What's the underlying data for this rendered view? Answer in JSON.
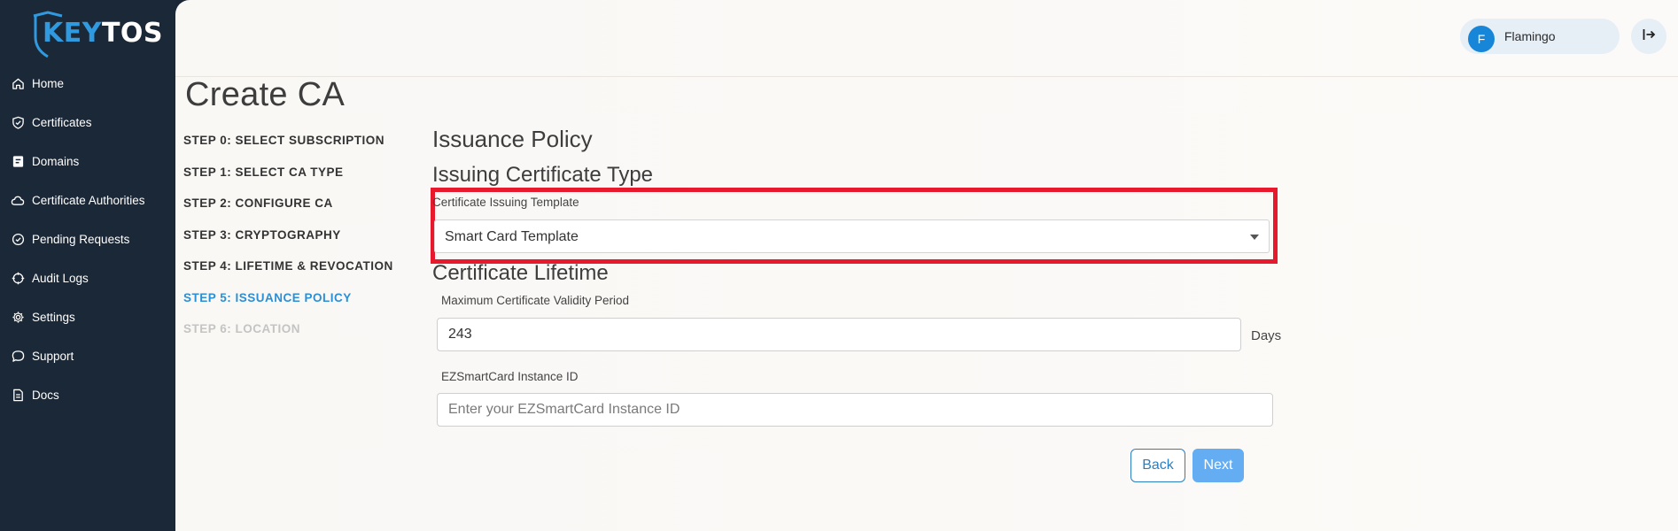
{
  "brand": {
    "logo_key": "KEY",
    "logo_tos": "TOS",
    "accent": "#2f9ae0"
  },
  "sidebar": {
    "items": [
      {
        "label": "Home",
        "icon": "home-icon"
      },
      {
        "label": "Certificates",
        "icon": "shield-check-icon"
      },
      {
        "label": "Domains",
        "icon": "domain-book-icon"
      },
      {
        "label": "Certificate Authorities",
        "icon": "cloud-icon"
      },
      {
        "label": "Pending Requests",
        "icon": "check-circle-icon"
      },
      {
        "label": "Audit Logs",
        "icon": "crosshair-icon"
      },
      {
        "label": "Settings",
        "icon": "gear-icon"
      },
      {
        "label": "Support",
        "icon": "chat-bubble-icon"
      },
      {
        "label": "Docs",
        "icon": "document-icon"
      }
    ]
  },
  "header": {
    "user_initial": "F",
    "user_name": "Flamingo",
    "logout_icon": "logout-icon"
  },
  "page": {
    "title": "Create CA"
  },
  "steps": [
    {
      "label": "STEP 0: SELECT SUBSCRIPTION",
      "state": "done"
    },
    {
      "label": "STEP 1: SELECT CA TYPE",
      "state": "done"
    },
    {
      "label": "STEP 2: CONFIGURE CA",
      "state": "done"
    },
    {
      "label": "STEP 3: CRYPTOGRAPHY",
      "state": "done"
    },
    {
      "label": "STEP 4: LIFETIME & REVOCATION",
      "state": "done"
    },
    {
      "label": "STEP 5: ISSUANCE POLICY",
      "state": "active"
    },
    {
      "label": "STEP 6: LOCATION",
      "state": "disabled"
    }
  ],
  "form": {
    "section_title": "Issuance Policy",
    "issuing_type_title": "Issuing Certificate Type",
    "template_label": "Certificate Issuing Template",
    "template_value": "Smart Card Template",
    "lifetime_title": "Certificate Lifetime",
    "validity_label": "Maximum Certificate Validity Period",
    "validity_value": "243",
    "validity_suffix": "Days",
    "instance_label": "EZSmartCard Instance ID",
    "instance_value": "",
    "instance_placeholder": "Enter your EZSmartCard Instance ID",
    "back_label": "Back",
    "next_label": "Next"
  },
  "colors": {
    "sidebar_bg": "#1b2838",
    "highlight": "#e8192c",
    "active_step": "#2b8fd6",
    "next_button": "#64adf2"
  }
}
